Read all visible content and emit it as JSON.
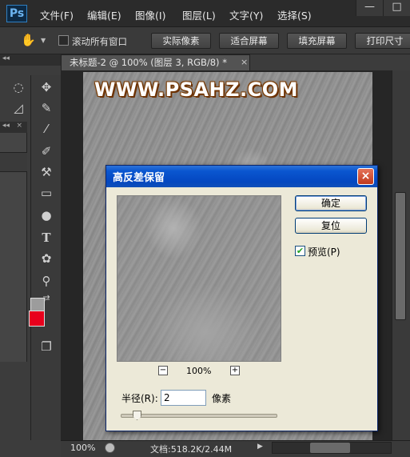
{
  "app": {
    "logo": "Ps",
    "menu": [
      "文件(F)",
      "编辑(E)",
      "图像(I)",
      "图层(L)",
      "文字(Y)",
      "选择(S)"
    ],
    "window_controls": [
      "—",
      "□"
    ]
  },
  "options_bar": {
    "scroll_all_windows_label": "滚动所有窗口",
    "scroll_all_windows_checked": false,
    "buttons": [
      "实际像素",
      "适合屏幕",
      "填充屏幕",
      "打印尺寸"
    ]
  },
  "document": {
    "tab_title": "未标题-2 @ 100% (图层 3, RGB/8) *",
    "tab_close": "×",
    "watermark": "WWW.PSAHZ.COM",
    "zoom": "100%",
    "doc_size": "文档:518.2K/2.44M"
  },
  "colors": {
    "foreground": "#9c9c9c",
    "background": "#e8001c"
  },
  "dialog": {
    "title": "高反差保留",
    "close": "×",
    "ok_label": "确定",
    "reset_label": "复位",
    "preview_label": "预览(P)",
    "preview_checked": true,
    "zoom_percent": "100%",
    "zoom_minus": "−",
    "zoom_plus": "+",
    "radius_label": "半径(R):",
    "radius_value": "2",
    "radius_unit": "像素"
  }
}
